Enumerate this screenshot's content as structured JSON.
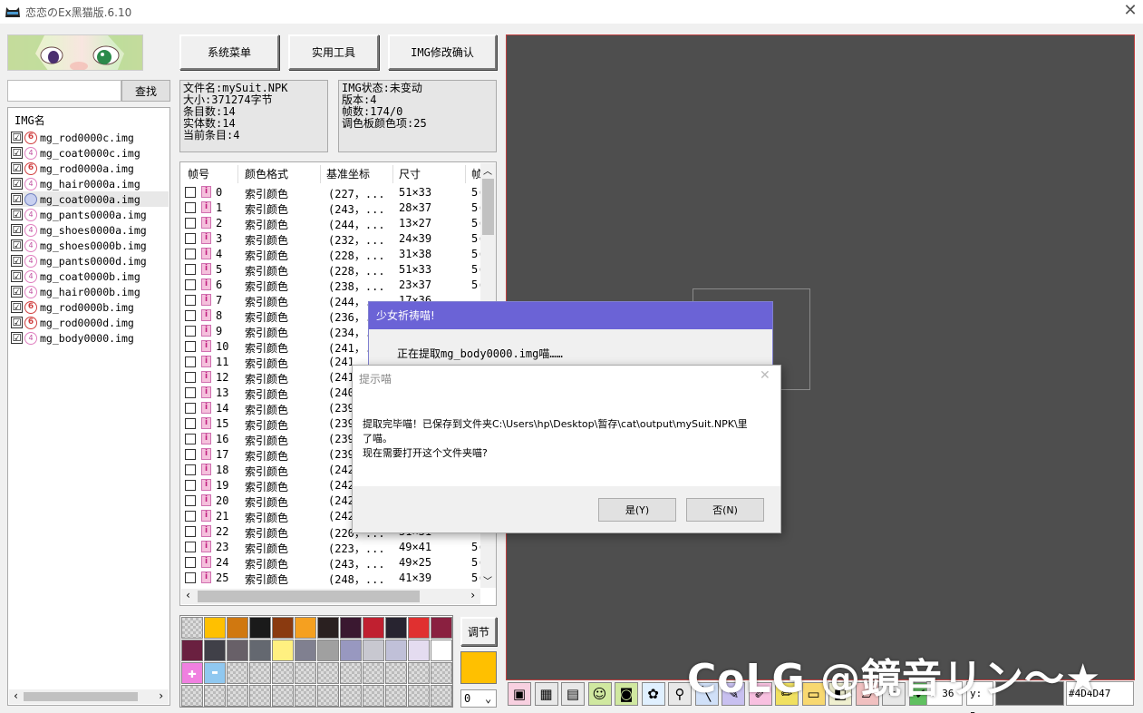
{
  "window": {
    "title": "恋恋のEx黑猫版.6.10",
    "close": "✕"
  },
  "search": {
    "button": "查找",
    "value": ""
  },
  "img_list": {
    "header": "IMG名",
    "items": [
      {
        "name": "mg_rod0000c.img",
        "icon": "6",
        "checked": "☑"
      },
      {
        "name": "mg_coat0000c.img",
        "icon": "4",
        "checked": "☑"
      },
      {
        "name": "mg_rod0000a.img",
        "icon": "6",
        "checked": "☑"
      },
      {
        "name": "mg_hair0000a.img",
        "icon": "4",
        "checked": "☑"
      },
      {
        "name": "mg_coat0000a.img",
        "icon": "b",
        "checked": "☑"
      },
      {
        "name": "mg_pants0000a.img",
        "icon": "4",
        "checked": "☑"
      },
      {
        "name": "mg_shoes0000a.img",
        "icon": "4",
        "checked": "☑"
      },
      {
        "name": "mg_shoes0000b.img",
        "icon": "4",
        "checked": "☑"
      },
      {
        "name": "mg_pants0000d.img",
        "icon": "4",
        "checked": "☑"
      },
      {
        "name": "mg_coat0000b.img",
        "icon": "4",
        "checked": "☑"
      },
      {
        "name": "mg_hair0000b.img",
        "icon": "4",
        "checked": "☑"
      },
      {
        "name": "mg_rod0000b.img",
        "icon": "6",
        "checked": "☑"
      },
      {
        "name": "mg_rod0000d.img",
        "icon": "6",
        "checked": "☑"
      },
      {
        "name": "mg_body0000.img",
        "icon": "4",
        "checked": "☑"
      }
    ]
  },
  "toolbar": {
    "system_menu": "系统菜单",
    "tools": "实用工具",
    "img_confirm": "IMG修改确认"
  },
  "file_info": {
    "line1": "文件名:mySuit.NPK",
    "line2": "大小:371274字节",
    "line3": "条目数:14",
    "line4": "实体数:14",
    "line5": "当前条目:4"
  },
  "img_info": {
    "line1": "IMG状态:未变动",
    "line2": "版本:4",
    "line3": "帧数:174/0",
    "line4": "调色板颜色项:25"
  },
  "frame_table": {
    "headers": [
      "帧号",
      "颜色格式",
      "基准坐标",
      "尺寸",
      "帧"
    ],
    "rows": [
      {
        "n": "0",
        "fmt": "索引颜色",
        "pos": "(227，...",
        "size": "51×33",
        "x": "5("
      },
      {
        "n": "1",
        "fmt": "索引颜色",
        "pos": "(243，...",
        "size": "28×37",
        "x": "5("
      },
      {
        "n": "2",
        "fmt": "索引颜色",
        "pos": "(244，...",
        "size": "13×27",
        "x": "5("
      },
      {
        "n": "3",
        "fmt": "索引颜色",
        "pos": "(232，...",
        "size": "24×39",
        "x": "5("
      },
      {
        "n": "4",
        "fmt": "索引颜色",
        "pos": "(228，...",
        "size": "31×38",
        "x": "5("
      },
      {
        "n": "5",
        "fmt": "索引颜色",
        "pos": "(228，...",
        "size": "51×33",
        "x": "5("
      },
      {
        "n": "6",
        "fmt": "索引颜色",
        "pos": "(238，...",
        "size": "23×37",
        "x": "5("
      },
      {
        "n": "7",
        "fmt": "索引颜色",
        "pos": "(244，...",
        "size": "17×36",
        "x": ""
      },
      {
        "n": "8",
        "fmt": "索引颜色",
        "pos": "(236，...",
        "size": "",
        "x": ""
      },
      {
        "n": "9",
        "fmt": "索引颜色",
        "pos": "(234，...",
        "size": "",
        "x": ""
      },
      {
        "n": "10",
        "fmt": "索引颜色",
        "pos": "(241，...",
        "size": "",
        "x": ""
      },
      {
        "n": "11",
        "fmt": "索引颜色",
        "pos": "(241",
        "size": "",
        "x": ""
      },
      {
        "n": "12",
        "fmt": "索引颜色",
        "pos": "(241",
        "size": "",
        "x": ""
      },
      {
        "n": "13",
        "fmt": "索引颜色",
        "pos": "(240",
        "size": "",
        "x": ""
      },
      {
        "n": "14",
        "fmt": "索引颜色",
        "pos": "(239",
        "size": "",
        "x": ""
      },
      {
        "n": "15",
        "fmt": "索引颜色",
        "pos": "(239",
        "size": "",
        "x": ""
      },
      {
        "n": "16",
        "fmt": "索引颜色",
        "pos": "(239",
        "size": "",
        "x": ""
      },
      {
        "n": "17",
        "fmt": "索引颜色",
        "pos": "(239",
        "size": "",
        "x": ""
      },
      {
        "n": "18",
        "fmt": "索引颜色",
        "pos": "(242",
        "size": "",
        "x": ""
      },
      {
        "n": "19",
        "fmt": "索引颜色",
        "pos": "(242",
        "size": "",
        "x": ""
      },
      {
        "n": "20",
        "fmt": "索引颜色",
        "pos": "(242",
        "size": "",
        "x": ""
      },
      {
        "n": "21",
        "fmt": "索引颜色",
        "pos": "(242",
        "size": "",
        "x": ""
      },
      {
        "n": "22",
        "fmt": "索引颜色",
        "pos": "(220，...",
        "size": "51×31",
        "x": ""
      },
      {
        "n": "23",
        "fmt": "索引颜色",
        "pos": "(223，...",
        "size": "49×41",
        "x": "5("
      },
      {
        "n": "24",
        "fmt": "索引颜色",
        "pos": "(243，...",
        "size": "49×25",
        "x": "5("
      },
      {
        "n": "25",
        "fmt": "索引颜色",
        "pos": "(248，...",
        "size": "41×39",
        "x": "5("
      }
    ]
  },
  "palette": {
    "colors": [
      "#ffc000",
      "#d07810",
      "#1a1a1a",
      "#8a3a10",
      "#f5a020",
      "#2a2020",
      "#3a1830",
      "#c02030",
      "#282430",
      "#e03030",
      "#8a2040",
      "#6a2040",
      "#404048",
      "#686068",
      "#646870",
      "#fff080",
      "#808090",
      "#a0a0a0",
      "#9898c0",
      "#c8c8d0",
      "#c0c0d8",
      "#e4dcf0",
      "#ffffff",
      "#f080e0",
      "#90c8f0"
    ],
    "plus": "✚",
    "minus": "▬"
  },
  "adjust_button": "调节",
  "current_color": "#ffc000",
  "zero_select": {
    "value": "0",
    "arrow": "⌄"
  },
  "status": {
    "x": ": 36",
    "y": "y: 5",
    "hex": "#4D4D47"
  },
  "watermark": "CoLG @鏡音リン～★",
  "progress_dialog": {
    "title": "少女祈祷喵!",
    "text": "正在提取mg_body0000.img喵……"
  },
  "message_box": {
    "title": "提示喵",
    "close": "✕",
    "line1": "提取完毕喵！已保存到文件夹C:\\Users\\hp\\Desktop\\暂存\\cat\\output\\mySuit.NPK\\里",
    "line2": "了喵。",
    "line3": "现在需要打开这个文件夹喵?",
    "yes": "是(Y)",
    "no": "否(N)"
  },
  "tools": [
    "frame-icon",
    "palette-icon",
    "film-icon",
    "cat-face-icon",
    "camera-icon",
    "paw-icon",
    "magnifier-icon",
    "line-icon",
    "pen-icon",
    "brush-icon",
    "pencil-icon",
    "rect-icon",
    "fill-icon",
    "eraser-icon",
    "eyedropper-icon",
    "check-icon"
  ]
}
